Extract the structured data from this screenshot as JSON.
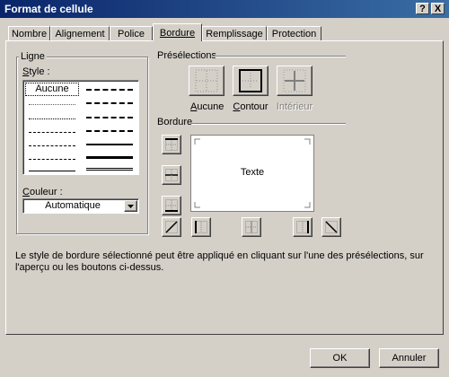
{
  "window": {
    "title": "Format de cellule",
    "help": "?",
    "close": "X"
  },
  "tabs": [
    {
      "label": "Nombre"
    },
    {
      "label": "Alignement"
    },
    {
      "label": "Police"
    },
    {
      "label": "Bordure"
    },
    {
      "label": "Remplissage"
    },
    {
      "label": "Protection"
    }
  ],
  "active_tab": "Bordure",
  "ligne": {
    "group_label": "Ligne",
    "style_label": "Style :",
    "none_label": "Aucune",
    "couleur_label": "Couleur :",
    "couleur_value": "Automatique"
  },
  "presets": {
    "group_label": "Présélections",
    "aucune": "Aucune",
    "contour": "Contour",
    "interieur": "Intérieur"
  },
  "bordure": {
    "group_label": "Bordure",
    "preview_text": "Texte"
  },
  "info_text": "Le style de bordure sélectionné peut être appliqué en cliquant sur l'une des présélections, sur l'aperçu ou les boutons ci-dessus.",
  "buttons": {
    "ok": "OK",
    "cancel": "Annuler"
  },
  "colors": {
    "titlebar": "#0a246a",
    "face": "#d4d0c8",
    "disabled": "#808080"
  }
}
